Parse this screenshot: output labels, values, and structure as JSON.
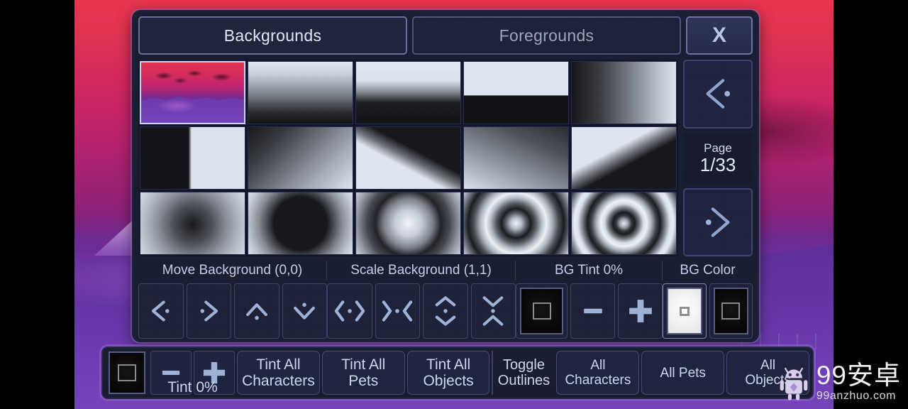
{
  "tabs": [
    {
      "label": "Backgrounds",
      "active": true
    },
    {
      "label": "Foregrounds",
      "active": false
    }
  ],
  "close_label": "X",
  "pager": {
    "page_label": "Page",
    "page_value": "1/33",
    "prev_icon": "chevron-left-dot-icon",
    "next_icon": "chevron-right-dot-icon"
  },
  "thumbnails": [
    {
      "name": "landscape-purple-sunset",
      "selected": true
    },
    {
      "name": "gradient-white-to-black-vertical",
      "selected": false
    },
    {
      "name": "gradient-sharp-white-to-black",
      "selected": false
    },
    {
      "name": "split-horizontal-white-black",
      "selected": false
    },
    {
      "name": "gradient-black-to-white-horizontal",
      "selected": false
    },
    {
      "name": "split-vertical-black-white",
      "selected": false
    },
    {
      "name": "gradient-diagonal-dark-light",
      "selected": false
    },
    {
      "name": "split-diagonal-black-white-up",
      "selected": false
    },
    {
      "name": "gradient-diagonal-soft",
      "selected": false
    },
    {
      "name": "split-diagonal-white-black-down",
      "selected": false
    },
    {
      "name": "radial-dark-center-soft",
      "selected": false
    },
    {
      "name": "radial-dark-disc-hard",
      "selected": false
    },
    {
      "name": "radial-light-center-ring",
      "selected": false
    },
    {
      "name": "concentric-rings-two",
      "selected": false
    },
    {
      "name": "concentric-rings-three",
      "selected": false
    }
  ],
  "controls": {
    "headers": [
      "Move Background (0,0)",
      "Scale Background (1,1)",
      "BG Tint 0%",
      "BG Color"
    ],
    "move_buttons": [
      {
        "icon": "arrow-left-dot-icon"
      },
      {
        "icon": "arrow-right-dot-icon"
      },
      {
        "icon": "arrow-up-dot-icon"
      },
      {
        "icon": "arrow-down-dot-icon"
      }
    ],
    "scale_buttons": [
      {
        "icon": "expand-horizontal-icon"
      },
      {
        "icon": "contract-horizontal-icon"
      },
      {
        "icon": "expand-vertical-icon"
      },
      {
        "icon": "contract-vertical-icon"
      }
    ],
    "tint_buttons": [
      {
        "icon": "color-swatch-dark-icon"
      },
      {
        "icon": "minus-icon"
      },
      {
        "icon": "plus-icon"
      }
    ],
    "color_buttons": [
      {
        "icon": "color-swatch-white-icon",
        "selected": true
      },
      {
        "icon": "color-swatch-black-icon",
        "selected": false
      }
    ]
  },
  "bottom": {
    "tint_swatch_icon": "color-swatch-dark-icon",
    "minus_icon": "minus-icon",
    "plus_icon": "plus-icon",
    "tint_label": "Tint 0%",
    "buttons": [
      "Tint All\nCharacters",
      "Tint All\nPets",
      "Tint All\nObjects"
    ],
    "toggle_outlines_label": "Toggle\nOutlines",
    "outline_buttons": [
      "All\nCharacters",
      "All Pets",
      "All\nObjects"
    ]
  },
  "watermark": {
    "main": "99安卓",
    "sub": "99anzhuo.com",
    "logo_icon": "android-robot-icon"
  },
  "colors": {
    "panel_bg": "#1b1f33",
    "accent_border": "#6a73a6",
    "text": "#ccd7ee",
    "icon": "#9eb2d8",
    "outer_glow": "#9664cd"
  }
}
